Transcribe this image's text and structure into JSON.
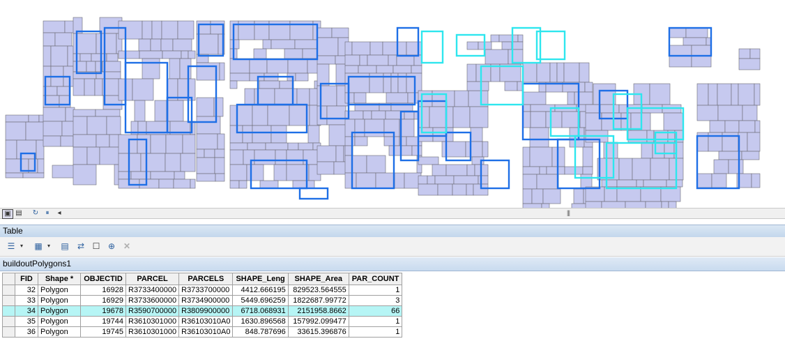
{
  "map": {
    "fill_color": "#c6c9ef",
    "parcel_edge": "#6a6a72",
    "selection_color": "#1e6fe6",
    "highlight_color": "#2ee6ee"
  },
  "table_window": {
    "title": "Table",
    "layer_tab": "buildoutPolygons1"
  },
  "attribute_table": {
    "columns": [
      "FID",
      "Shape *",
      "OBJECTID",
      "PARCEL",
      "PARCELS",
      "SHAPE_Leng",
      "SHAPE_Area",
      "PAR_COUNT"
    ],
    "rows": [
      [
        "32",
        "Polygon",
        "16928",
        "R3733400000",
        "R3733700000",
        "4412.666195",
        "829523.564555",
        "1"
      ],
      [
        "33",
        "Polygon",
        "16929",
        "R3733600000",
        "R3734900000",
        "5449.696259",
        "1822687.99772",
        "3"
      ],
      [
        "34",
        "Polygon",
        "19678",
        "R3590700000",
        "R3809900000",
        "6718.068931",
        "2151958.8662",
        "66"
      ],
      [
        "35",
        "Polygon",
        "19744",
        "R3610301000",
        "R36103010A0",
        "1630.896568",
        "157992.099477",
        "1"
      ],
      [
        "36",
        "Polygon",
        "19745",
        "R3610301000",
        "R36103010A0",
        "848.787696",
        "33615.396876",
        "1"
      ]
    ],
    "highlighted_row": 2
  }
}
